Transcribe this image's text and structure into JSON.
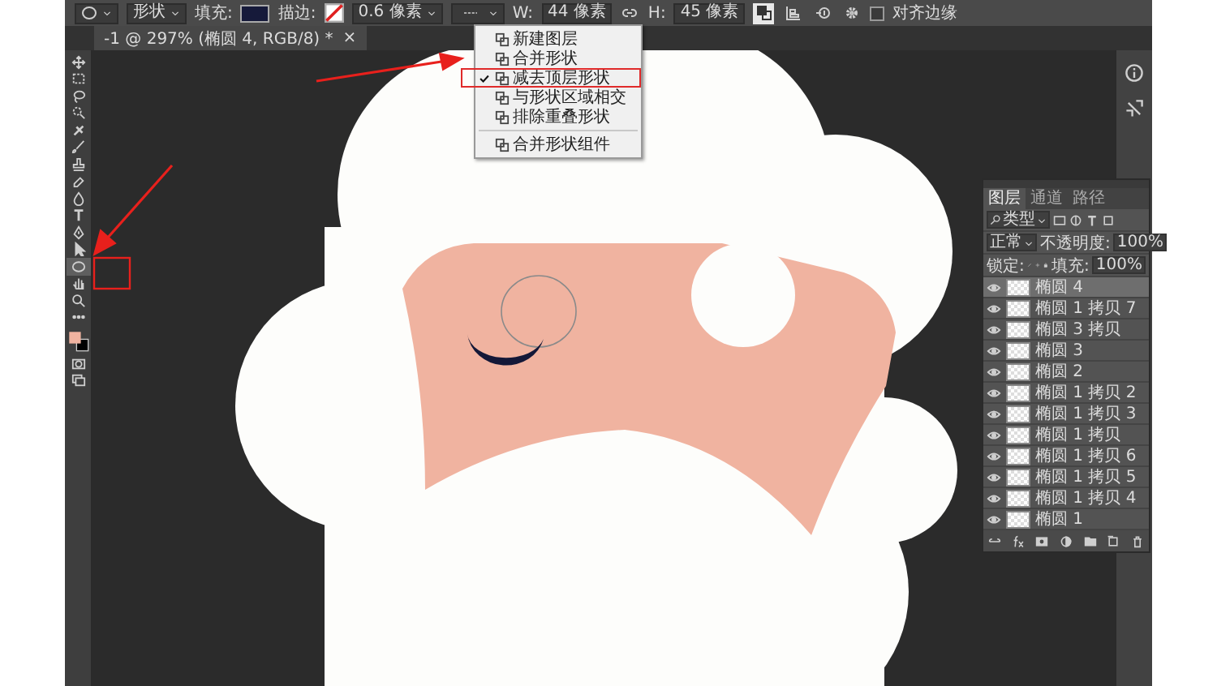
{
  "options_bar": {
    "shape_mode": "形状",
    "fill_label": "填充:",
    "stroke_label": "描边:",
    "stroke_width": "0.6 像素",
    "w_label": "W:",
    "w_value": "44 像素",
    "h_label": "H:",
    "h_value": "45 像素",
    "align_edges": {
      "label": "对齐边缘",
      "checked": false
    }
  },
  "document_tab": {
    "title": "-1 @ 297% (椭圆 4, RGB/8) *",
    "close": "×"
  },
  "path_ops_menu": {
    "items": [
      {
        "label": "新建图层",
        "checked": false
      },
      {
        "label": "合并形状",
        "checked": false
      },
      {
        "label": "减去顶层形状",
        "checked": true
      },
      {
        "label": "与形状区域相交",
        "checked": false
      },
      {
        "label": "排除重叠形状",
        "checked": false
      }
    ],
    "footer_item": "合并形状组件"
  },
  "tools": [
    {
      "kind": "move",
      "selected": false
    },
    {
      "kind": "marquee",
      "selected": false
    },
    {
      "kind": "lasso",
      "selected": false
    },
    {
      "kind": "quick-select",
      "selected": false
    },
    {
      "kind": "healing",
      "selected": false
    },
    {
      "kind": "brush",
      "selected": false
    },
    {
      "kind": "stamp",
      "selected": false
    },
    {
      "kind": "eraser",
      "selected": false
    },
    {
      "kind": "drop",
      "selected": false
    },
    {
      "kind": "type",
      "selected": false
    },
    {
      "kind": "pen",
      "selected": false
    },
    {
      "kind": "path-select",
      "selected": false
    },
    {
      "kind": "ellipse",
      "selected": true
    },
    {
      "kind": "hand",
      "selected": false
    },
    {
      "kind": "zoom",
      "selected": false
    },
    {
      "kind": "more",
      "selected": false
    },
    {
      "kind": "colors",
      "selected": false
    },
    {
      "kind": "quick-mask",
      "selected": false
    },
    {
      "kind": "screen-mode",
      "selected": false
    }
  ],
  "layers_panel": {
    "tabs": [
      {
        "label": "图层",
        "selected": true
      },
      {
        "label": "通道",
        "selected": false
      },
      {
        "label": "路径",
        "selected": false
      }
    ],
    "filter": "类型",
    "blend_mode": "正常",
    "opacity_label": "不透明度:",
    "opacity": "100%",
    "lock_label": "锁定:",
    "fill_label": "填充:",
    "fill": "100%",
    "layers": [
      {
        "name": "椭圆 4",
        "selected": true,
        "visible": true
      },
      {
        "name": "椭圆 1 拷贝 7",
        "selected": false,
        "visible": true
      },
      {
        "name": "椭圆 3 拷贝",
        "selected": false,
        "visible": true
      },
      {
        "name": "椭圆 3",
        "selected": false,
        "visible": true
      },
      {
        "name": "椭圆 2",
        "selected": false,
        "visible": true
      },
      {
        "name": "椭圆 1 拷贝 2",
        "selected": false,
        "visible": true
      },
      {
        "name": "椭圆 1 拷贝 3",
        "selected": false,
        "visible": true
      },
      {
        "name": "椭圆 1 拷贝",
        "selected": false,
        "visible": true
      },
      {
        "name": "椭圆 1 拷贝 6",
        "selected": false,
        "visible": true
      },
      {
        "name": "椭圆 1 拷贝 5",
        "selected": false,
        "visible": true
      },
      {
        "name": "椭圆 1 拷贝 4",
        "selected": false,
        "visible": true
      },
      {
        "name": "椭圆 1",
        "selected": false,
        "visible": true
      }
    ]
  }
}
